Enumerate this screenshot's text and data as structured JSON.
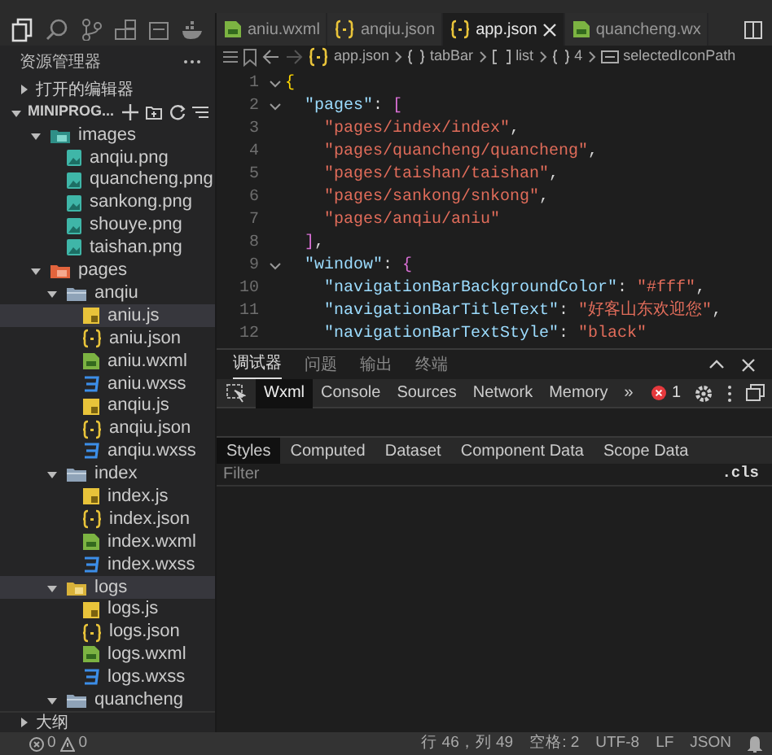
{
  "sidebar": {
    "title": "资源管理器",
    "sections": [
      {
        "label": "打开的编辑器",
        "expanded": false
      },
      {
        "label": "MINIPROG...",
        "expanded": true
      }
    ],
    "tree": [
      {
        "label": "images",
        "kind": "images",
        "expanded": true,
        "selected": false,
        "children": [
          {
            "label": "anqiu.png",
            "kind": "png",
            "selected": false
          },
          {
            "label": "quancheng.png",
            "kind": "png",
            "selected": false
          },
          {
            "label": "sankong.png",
            "kind": "png",
            "selected": false
          },
          {
            "label": "shouye.png",
            "kind": "png",
            "selected": false
          },
          {
            "label": "taishan.png",
            "kind": "png",
            "selected": false
          }
        ]
      },
      {
        "label": "pages",
        "kind": "pages",
        "expanded": true,
        "selected": false,
        "children": [
          {
            "label": "anqiu",
            "kind": "folder",
            "expanded": true,
            "selected": false,
            "children": [
              {
                "label": "aniu.js",
                "kind": "js",
                "selected": true
              },
              {
                "label": "aniu.json",
                "kind": "json",
                "selected": false
              },
              {
                "label": "aniu.wxml",
                "kind": "wxml",
                "selected": false
              },
              {
                "label": "aniu.wxss",
                "kind": "wxss",
                "selected": false
              },
              {
                "label": "anqiu.js",
                "kind": "js",
                "selected": false
              },
              {
                "label": "anqiu.json",
                "kind": "json",
                "selected": false
              },
              {
                "label": "anqiu.wxss",
                "kind": "wxss",
                "selected": false
              }
            ]
          },
          {
            "label": "index",
            "kind": "folder",
            "expanded": true,
            "selected": false,
            "children": [
              {
                "label": "index.js",
                "kind": "js",
                "selected": false
              },
              {
                "label": "index.json",
                "kind": "json",
                "selected": false
              },
              {
                "label": "index.wxml",
                "kind": "wxml",
                "selected": false
              },
              {
                "label": "index.wxss",
                "kind": "wxss",
                "selected": false
              }
            ]
          },
          {
            "label": "logs",
            "kind": "logs",
            "expanded": true,
            "selected": true,
            "children": [
              {
                "label": "logs.js",
                "kind": "js",
                "selected": false
              },
              {
                "label": "logs.json",
                "kind": "json",
                "selected": false
              },
              {
                "label": "logs.wxml",
                "kind": "wxml",
                "selected": false
              },
              {
                "label": "logs.wxss",
                "kind": "wxss",
                "selected": false
              }
            ]
          },
          {
            "label": "quancheng",
            "kind": "folder",
            "expanded": true,
            "selected": false
          }
        ]
      }
    ],
    "outline": {
      "label": "大纲",
      "expanded": false
    },
    "problems": {
      "errors": "0",
      "warnings": "0"
    }
  },
  "editor": {
    "tabs": [
      {
        "label": "aniu.wxml",
        "kind": "wxml",
        "selected": false
      },
      {
        "label": "anqiu.json",
        "kind": "json",
        "selected": false
      },
      {
        "label": "app.json",
        "kind": "json",
        "selected": true
      },
      {
        "label": "quancheng.wx",
        "kind": "wxml",
        "selected": false
      }
    ],
    "breadcrumb": [
      {
        "label": "app.json",
        "kind": "json"
      },
      {
        "label": "tabBar",
        "kind": "object"
      },
      {
        "label": "list",
        "kind": "array"
      },
      {
        "label": "4",
        "kind": "object"
      },
      {
        "label": "selectedIconPath",
        "kind": "property"
      }
    ],
    "lines": [
      {
        "number": "1",
        "foldable": true,
        "parts": [
          {
            "kind": "brace",
            "text": "{"
          }
        ],
        "children": [
          {
            "number": "2",
            "foldable": true,
            "parts": [
              {
                "kind": "key",
                "text": "\"pages\""
              },
              {
                "kind": "punct",
                "text": ": "
              },
              {
                "kind": "bracket",
                "text": "["
              }
            ],
            "children": [
              {
                "number": "3",
                "parts": [
                  {
                    "kind": "string",
                    "text": "\"pages/index/index\""
                  },
                  {
                    "kind": "punct",
                    "text": ","
                  }
                ]
              },
              {
                "number": "4",
                "parts": [
                  {
                    "kind": "string",
                    "text": "\"pages/quancheng/quancheng\""
                  },
                  {
                    "kind": "punct",
                    "text": ","
                  }
                ]
              },
              {
                "number": "5",
                "parts": [
                  {
                    "kind": "string",
                    "text": "\"pages/taishan/taishan\""
                  },
                  {
                    "kind": "punct",
                    "text": ","
                  }
                ]
              },
              {
                "number": "6",
                "parts": [
                  {
                    "kind": "string",
                    "text": "\"pages/sankong/snkong\""
                  },
                  {
                    "kind": "punct",
                    "text": ","
                  }
                ]
              },
              {
                "number": "7",
                "parts": [
                  {
                    "kind": "string",
                    "text": "\"pages/anqiu/aniu\""
                  }
                ]
              }
            ]
          },
          {
            "number": "8",
            "parts": [
              {
                "kind": "bracket",
                "text": "]"
              },
              {
                "kind": "punct",
                "text": ","
              }
            ]
          },
          {
            "number": "9",
            "foldable": true,
            "parts": [
              {
                "kind": "key",
                "text": "\"window\""
              },
              {
                "kind": "punct",
                "text": ": "
              },
              {
                "kind": "bracket",
                "text": "{"
              }
            ],
            "children": [
              {
                "number": "10",
                "parts": [
                  {
                    "kind": "key",
                    "text": "\"navigationBarBackgroundColor\""
                  },
                  {
                    "kind": "punct",
                    "text": ": "
                  },
                  {
                    "kind": "string",
                    "text": "\"#fff\""
                  },
                  {
                    "kind": "punct",
                    "text": ","
                  }
                ]
              },
              {
                "number": "11",
                "parts": [
                  {
                    "kind": "key",
                    "text": "\"navigationBarTitleText\""
                  },
                  {
                    "kind": "punct",
                    "text": ": "
                  },
                  {
                    "kind": "string",
                    "text": "\"好客山东欢迎您\""
                  },
                  {
                    "kind": "punct",
                    "text": ","
                  }
                ]
              },
              {
                "number": "12",
                "parts": [
                  {
                    "kind": "key",
                    "text": "\"navigationBarTextStyle\""
                  },
                  {
                    "kind": "punct",
                    "text": ": "
                  },
                  {
                    "kind": "string",
                    "text": "\"black\""
                  }
                ]
              }
            ]
          }
        ]
      }
    ]
  },
  "panel": {
    "tabs": [
      {
        "label": "调试器",
        "selected": true
      },
      {
        "label": "问题",
        "selected": false
      },
      {
        "label": "输出",
        "selected": false
      },
      {
        "label": "终端",
        "selected": false
      }
    ],
    "devtools_tabs": [
      {
        "label": "Wxml",
        "selected": true
      },
      {
        "label": "Console",
        "selected": false
      },
      {
        "label": "Sources",
        "selected": false
      },
      {
        "label": "Network",
        "selected": false
      },
      {
        "label": "Memory",
        "selected": false
      }
    ],
    "more": "»",
    "error_count": "1",
    "style_tabs": [
      {
        "label": "Styles",
        "selected": true
      },
      {
        "label": "Computed",
        "selected": false
      },
      {
        "label": "Dataset",
        "selected": false
      },
      {
        "label": "Component Data",
        "selected": false
      },
      {
        "label": "Scope Data",
        "selected": false
      }
    ],
    "filter": {
      "placeholder": "Filter"
    },
    "cls": ".cls"
  },
  "status_bar": [
    {
      "text": "行 46，列 49"
    },
    {
      "text": "空格: 2"
    },
    {
      "text": "UTF-8"
    },
    {
      "text": "LF"
    },
    {
      "text": "JSON"
    }
  ]
}
